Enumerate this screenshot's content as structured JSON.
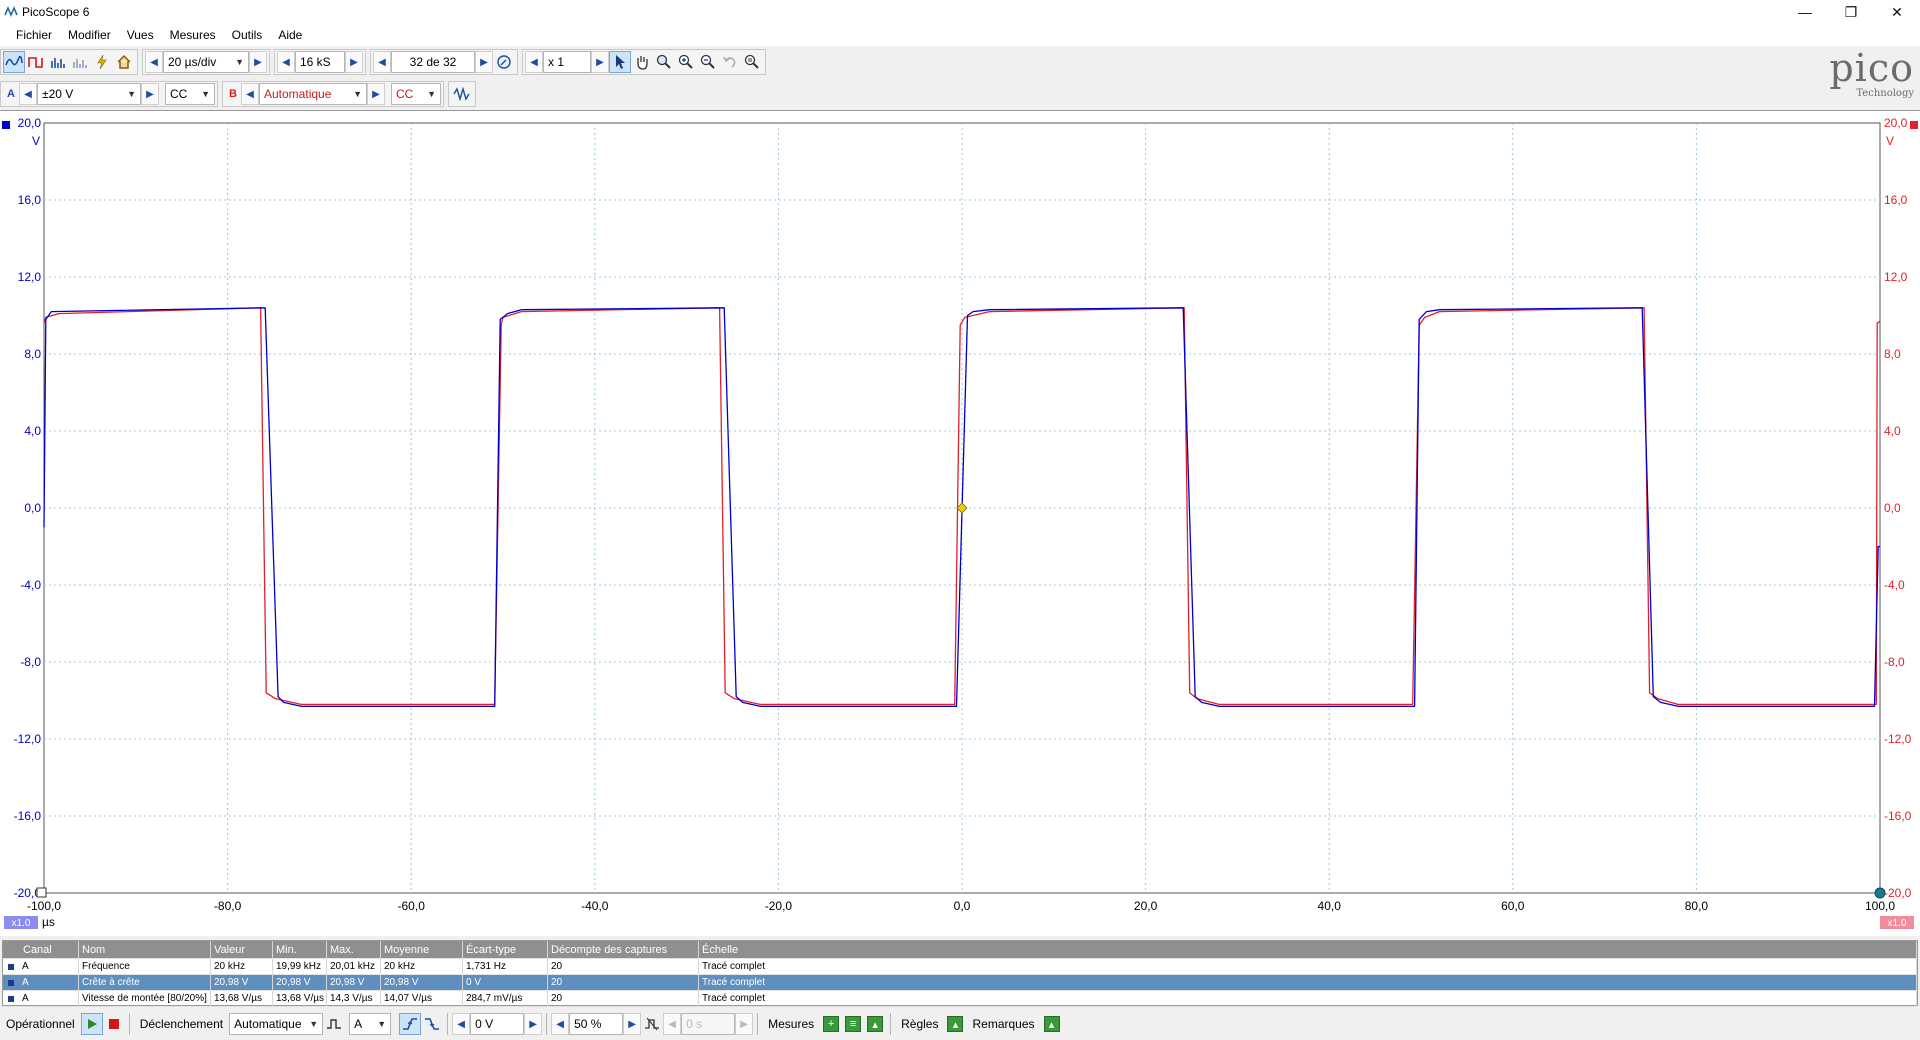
{
  "window": {
    "title": "PicoScope 6",
    "minimize": "—",
    "restore": "❐",
    "close": "✕"
  },
  "menu": [
    "Fichier",
    "Modifier",
    "Vues",
    "Mesures",
    "Outils",
    "Aide"
  ],
  "toolbar1": {
    "timebase": "20 µs/div",
    "samples": "16 kS",
    "capture": "32 de 32",
    "zoom": "x 1"
  },
  "toolbar2": {
    "channel_a": {
      "letter": "A",
      "range": "±20 V",
      "coupling": "CC"
    },
    "channel_b": {
      "letter": "B",
      "range": "Automatique",
      "coupling": "CC"
    }
  },
  "logo": {
    "word": "pico",
    "sub": "Technology"
  },
  "scope": {
    "left_unit": "V",
    "right_unit": "V",
    "x_unit": "µs",
    "left_scale_badge": "x1.0",
    "right_scale_badge": "x1.0",
    "y_ticks": [
      "20,0",
      "16,0",
      "12,0",
      "8,0",
      "4,0",
      "0,0",
      "-4,0",
      "-8,0",
      "-12,0",
      "-16,0",
      "-20,0"
    ],
    "x_ticks": [
      "-100,0",
      "-80,0",
      "-60,0",
      "-40,0",
      "-20,0",
      "0,0",
      "20,0",
      "40,0",
      "60,0",
      "80,0",
      "100,0"
    ]
  },
  "colors": {
    "channel_a": "#0000cc",
    "channel_b": "#e0202a",
    "grid": "#9dc9dd",
    "trigger": "#e8d000"
  },
  "chart_data": {
    "type": "line",
    "xlabel": "µs",
    "ylabel": "V",
    "xlim": [
      -100,
      100
    ],
    "ylim": [
      -20,
      20
    ],
    "grid": true,
    "series": [
      {
        "name": "A",
        "x": [
          -100,
          -99.8,
          -99.2,
          -75.9,
          -74.5,
          -73.9,
          -72,
          -50.9,
          -50.3,
          -49.5,
          -48,
          -25.9,
          -24.6,
          -23.9,
          -22,
          -0.6,
          0.6,
          1.2,
          3,
          24.1,
          25.4,
          26.1,
          28,
          49.3,
          49.8,
          50.6,
          52,
          74.1,
          75.3,
          76.1,
          78,
          99.4,
          99.8,
          100
        ],
        "y": [
          -1,
          9.8,
          10.2,
          10.4,
          -9.8,
          -10.1,
          -10.3,
          -10.3,
          9.8,
          10.1,
          10.3,
          10.4,
          -9.8,
          -10.1,
          -10.3,
          -10.3,
          10,
          10.2,
          10.3,
          10.4,
          -9.8,
          -10.1,
          -10.3,
          -10.3,
          9.8,
          10.2,
          10.3,
          10.4,
          -9.8,
          -10.1,
          -10.3,
          -10.3,
          -2.0,
          -2.0
        ]
      },
      {
        "name": "B",
        "x": [
          -100,
          -99.8,
          -98.4,
          -76.4,
          -75.8,
          -74.8,
          -72,
          -50.9,
          -50.2,
          -50,
          -48,
          -26.4,
          -25.8,
          -24.8,
          -22,
          -0.8,
          -0.2,
          0.3,
          3,
          24.2,
          24.8,
          25.6,
          28,
          49.1,
          49.8,
          50.4,
          52,
          74.3,
          74.9,
          75.8,
          78,
          99.6,
          99.7,
          100
        ],
        "y": [
          9.6,
          9.9,
          10.1,
          10.4,
          -9.6,
          -9.9,
          -10.2,
          -10.2,
          9.5,
          9.9,
          10.2,
          10.4,
          -9.6,
          -9.9,
          -10.2,
          -10.2,
          9.5,
          9.9,
          10.2,
          10.4,
          -9.6,
          -9.9,
          -10.2,
          -10.2,
          9.5,
          9.9,
          10.2,
          10.4,
          -9.6,
          -9.9,
          -10.2,
          -10.2,
          9.6,
          9.7
        ]
      }
    ]
  },
  "measurements": {
    "headers": [
      "Canal",
      "Nom",
      "Valeur",
      "Min.",
      "Max.",
      "Moyenne",
      "Écart-type",
      "Décompte des captures",
      "Échelle"
    ],
    "rows": [
      [
        "A",
        "Fréquence",
        "20 kHz",
        "19,99 kHz",
        "20,01 kHz",
        "20 kHz",
        "1,731 Hz",
        "20",
        "Tracé complet"
      ],
      [
        "A",
        "Crête à crête",
        "20,98 V",
        "20,98 V",
        "20,98 V",
        "20,98 V",
        "0 V",
        "20",
        "Tracé complet"
      ],
      [
        "A",
        "Vitesse de montée [80/20%]",
        "13,68 V/µs",
        "13,68 V/µs",
        "14,3 V/µs",
        "14,07 V/µs",
        "284,7 mV/µs",
        "20",
        "Tracé complet"
      ]
    ]
  },
  "bottombar": {
    "status": "Opérationnel",
    "trigger_label": "Déclenchement",
    "trigger_mode": "Automatique",
    "trigger_source": "A",
    "threshold": "0 V",
    "pretrigger": "50 %",
    "delay": "0 s",
    "measures_label": "Mesures",
    "rules_label": "Règles",
    "notes_label": "Remarques"
  }
}
